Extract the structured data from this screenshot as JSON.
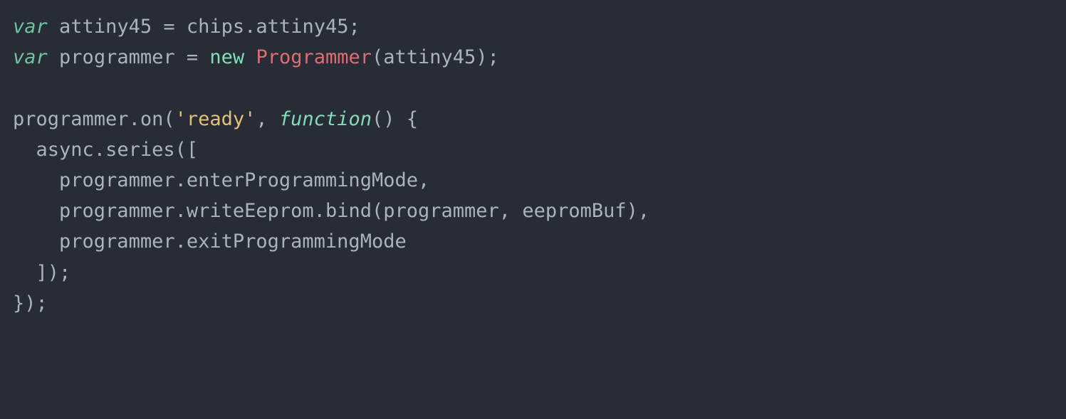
{
  "code": {
    "kw_var": "var",
    "kw_new": "new",
    "kw_function": "function",
    "line1": {
      "name": "attiny45",
      "rhs1": "chips",
      "dot": ".",
      "rhs2": "attiny45",
      "eq": " = ",
      "semi": ";"
    },
    "line2": {
      "name": "programmer",
      "eq": " = ",
      "class": "Programmer",
      "open": "(",
      "arg": "attiny45",
      "close": ")",
      "semi": ";"
    },
    "line4": {
      "obj": "programmer",
      "dot": ".",
      "method": "on",
      "open": "(",
      "str": "'ready'",
      "comma": ", ",
      "fn_open": "() {"
    },
    "line5": {
      "indent": "  ",
      "obj": "async",
      "dot": ".",
      "method": "series",
      "open": "(["
    },
    "line6": {
      "indent": "    ",
      "obj": "programmer",
      "dot": ".",
      "prop": "enterProgrammingMode",
      "tail": ","
    },
    "line7": {
      "indent": "    ",
      "obj": "programmer",
      "dot1": ".",
      "prop1": "writeEeprom",
      "dot2": ".",
      "prop2": "bind",
      "open": "(",
      "arg1": "programmer",
      "comma": ", ",
      "arg2": "eepromBuf",
      "close": ")",
      "tail": ","
    },
    "line8": {
      "indent": "    ",
      "obj": "programmer",
      "dot": ".",
      "prop": "exitProgrammingMode"
    },
    "line9": {
      "text": "  ]);"
    },
    "line10": {
      "text": "});"
    }
  }
}
